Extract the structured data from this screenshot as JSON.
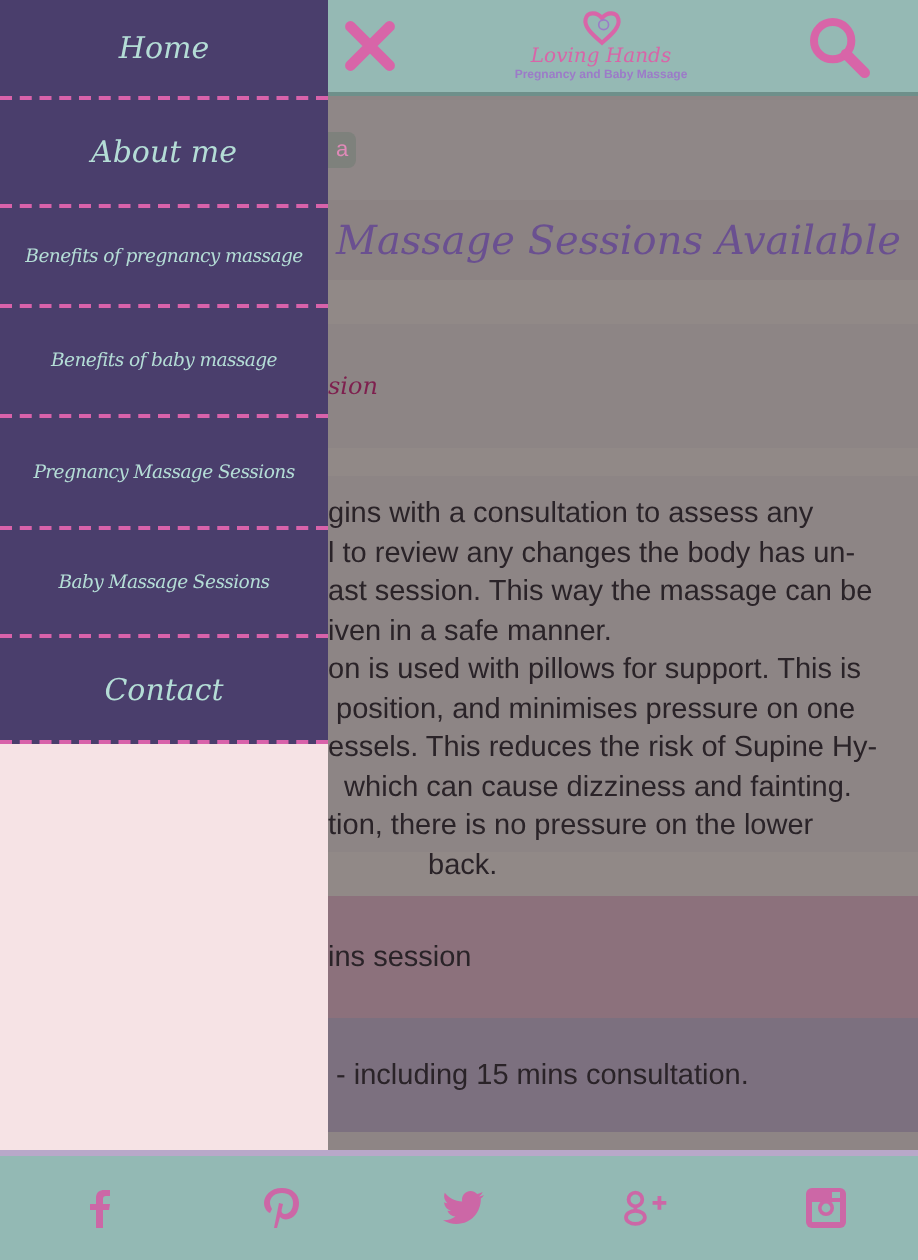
{
  "header": {
    "logo_title": "Loving Hands",
    "logo_subtitle": "Pregnancy and Baby Massage"
  },
  "menu": {
    "items": [
      {
        "label": "Home",
        "kind": "large"
      },
      {
        "label": "About me",
        "kind": "large"
      },
      {
        "label": "Benefits of pregnancy massage",
        "kind": "small"
      },
      {
        "label": "Benefits of baby massage",
        "kind": "small"
      },
      {
        "label": "Pregnancy Massage Sessions",
        "kind": "small"
      },
      {
        "label": "Baby Massage Sessions",
        "kind": "small"
      },
      {
        "label": "Contact",
        "kind": "large"
      }
    ]
  },
  "content": {
    "tag": "a",
    "title": "Massage Sessions Available",
    "subheading": "sion",
    "paragraph": [
      "gins with a consultation to assess any",
      "l to review any changes the body has un-",
      "ast session. This way the massage can be",
      "iven in a safe manner.",
      "on is used with pillows for support. This is",
      " position, and minimises pressure on one",
      "essels. This reduces the risk of Supine Hy-",
      "  which can cause dizziness and fainting.",
      "tion, there is no pressure on the lower",
      "back."
    ],
    "price_rows": [
      {
        "text": "ins session",
        "kind": "pink"
      },
      {
        "text": " - including 15 mins consultation.",
        "kind": "purple"
      }
    ]
  },
  "footer": {
    "icons": [
      {
        "kind": "facebook"
      },
      {
        "kind": "pinterest"
      },
      {
        "kind": "twitter"
      },
      {
        "kind": "googleplus"
      },
      {
        "kind": "instagram"
      }
    ]
  }
}
